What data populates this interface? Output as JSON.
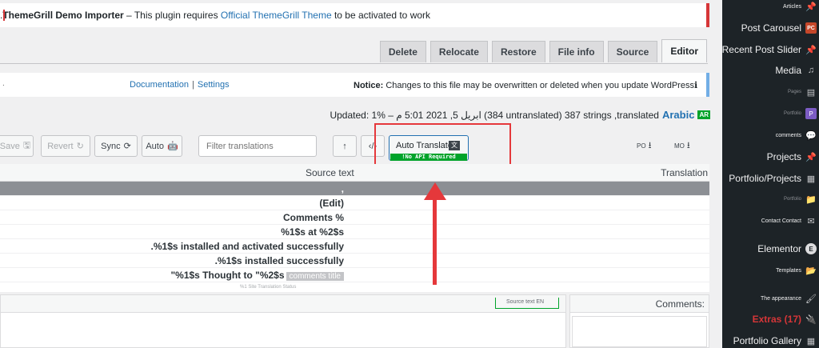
{
  "notice_error": {
    "plugin": "ThemeGrill Demo Importer",
    "text_before": " – This plugin requires ",
    "link": "Official ThemeGrill Theme",
    "text_after": " to be activated to work."
  },
  "tabs": [
    "Delete",
    "Relocate",
    "Restore",
    "File info",
    "Source",
    "Editor"
  ],
  "notice_info": {
    "dot": ".",
    "doc_link": "Documentation",
    "settings_link": "Settings",
    "label": "Notice:",
    "message": "Changes to this file may be overwritten or deleted when you update WordPress"
  },
  "stats": {
    "badge": "AR",
    "language": "Arabic",
    "text": "Updated: ابريل 5, 2021 5:01 م – %1 (384 untranslated) 387 strings ,translated"
  },
  "toolbar": {
    "save": "Save",
    "revert": "Revert",
    "sync": "Sync",
    "auto": "Auto",
    "filter_placeholder": "Filter translations",
    "auto_translate": "Auto Translate",
    "api_badge": "!No API Required",
    "po": "PO",
    "mo": "MO"
  },
  "columns": {
    "source": "Source text",
    "translation": "Translation"
  },
  "rows": [
    {
      "text": ","
    },
    {
      "text": "(Edit)"
    },
    {
      "text": "Comments %"
    },
    {
      "text": "%1$s at %2$s"
    },
    {
      "text": ".%1$s installed and activated successfully"
    },
    {
      "text": ".%1$s installed successfully"
    },
    {
      "text": "\"%1$s Thought to \"%2$s",
      "tag": "comments title"
    },
    {
      "text": "",
      "faint": "%1 Site Translation Status"
    }
  ],
  "bottom": {
    "source_en": "Source text EN",
    "comments": "Comments:"
  },
  "sidebar": [
    {
      "label": "Articles",
      "icon": "pin-icon",
      "size": "small"
    },
    {
      "label": "Post Carousel",
      "icon": "pc-icon",
      "size": "normal"
    },
    {
      "label": "Recent Post Slider",
      "icon": "pin-icon",
      "size": "normal"
    },
    {
      "label": "Media",
      "icon": "media-icon",
      "size": "normal"
    },
    {
      "label": "Pages",
      "icon": "page-icon",
      "size": "faint"
    },
    {
      "label": "Portfolio",
      "icon": "portfolio-icon",
      "size": "faint"
    },
    {
      "label": "comments",
      "icon": "comment-icon",
      "size": "small"
    },
    {
      "label": "Projects",
      "icon": "pin-icon",
      "size": "normal"
    },
    {
      "label": "Portfolio/Projects",
      "icon": "grid-icon",
      "size": "normal"
    },
    {
      "label": "Portfolio",
      "icon": "folder-icon",
      "size": "faint"
    },
    {
      "label": "Contact Contact",
      "icon": "mail-icon",
      "size": "small"
    },
    {
      "label": "Elementor",
      "icon": "elementor-icon",
      "size": "normal"
    },
    {
      "label": "Templates",
      "icon": "folder-icon",
      "size": "small"
    },
    {
      "label": "The appearance",
      "icon": "brush-icon",
      "size": "small"
    },
    {
      "label": "Extras (17)",
      "icon": "plug-icon",
      "size": "red"
    },
    {
      "label": "Portfolio Gallery",
      "icon": "gallery-icon",
      "size": "normal"
    }
  ]
}
